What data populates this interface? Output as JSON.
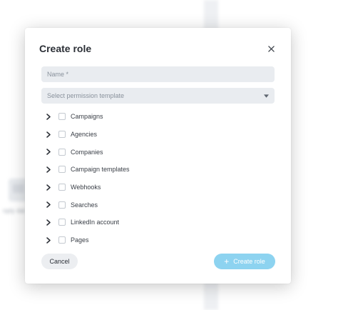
{
  "background": {
    "empty_state_text": "nply dat"
  },
  "modal": {
    "title": "Create role",
    "close_icon": "close-icon",
    "name_field": {
      "placeholder": "Name *",
      "value": ""
    },
    "permission_template": {
      "placeholder": "Select permission template",
      "icon": "caret-down-icon"
    },
    "permissions": [
      {
        "label": "Campaigns",
        "checked": false
      },
      {
        "label": "Agencies",
        "checked": false
      },
      {
        "label": "Companies",
        "checked": false
      },
      {
        "label": "Campaign templates",
        "checked": false
      },
      {
        "label": "Webhooks",
        "checked": false
      },
      {
        "label": "Searches",
        "checked": false
      },
      {
        "label": "LinkedIn account",
        "checked": false
      },
      {
        "label": "Pages",
        "checked": false
      }
    ],
    "cancel_label": "Cancel",
    "create_label": "Create role",
    "create_icon": "+"
  },
  "colors": {
    "primary_button": "#8dd3f0",
    "field_bg": "#e9ecf0",
    "cancel_bg": "#eceef1"
  }
}
